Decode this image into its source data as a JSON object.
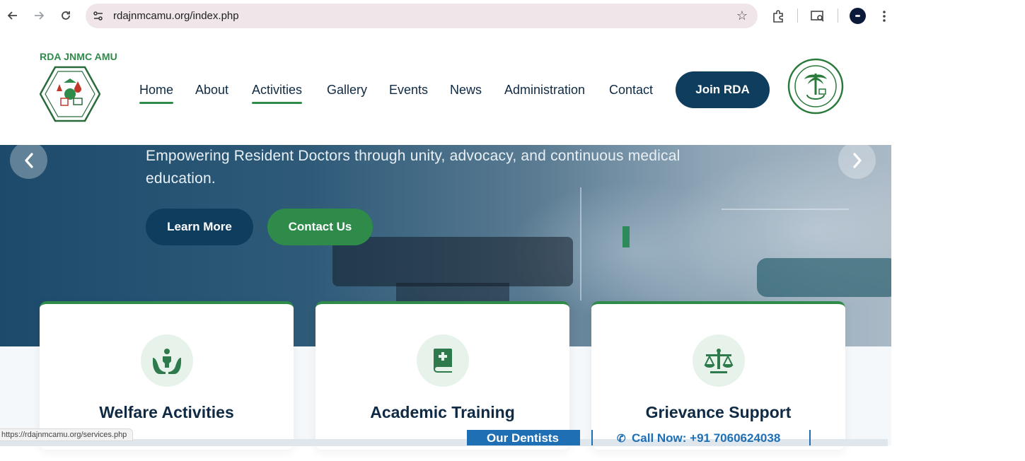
{
  "browser": {
    "url": "rdajnmcamu.org/index.php",
    "status_url": "https://rdajnmcamu.org/services.php",
    "icons": [
      "back-icon",
      "forward-icon",
      "reload-icon",
      "site-settings-icon",
      "bookmark-star-icon",
      "extensions-icon",
      "cast-search-icon",
      "profile-avatar",
      "menu-dots-icon"
    ]
  },
  "header": {
    "brand": "RDA JNMC AMU",
    "nav": [
      {
        "label": "Home",
        "active": true
      },
      {
        "label": "About",
        "active": false
      },
      {
        "label": "Activities",
        "active": true
      },
      {
        "label": "Gallery",
        "active": false
      },
      {
        "label": "Events",
        "active": false
      },
      {
        "label": "News",
        "active": false
      },
      {
        "label": "Administration",
        "active": false
      },
      {
        "label": "Contact",
        "active": false
      }
    ],
    "join_label": "Join RDA"
  },
  "hero": {
    "text": "Empowering Resident Doctors through unity, advocacy, and continuous medical education.",
    "learn_more": "Learn More",
    "contact_us": "Contact Us"
  },
  "cards": [
    {
      "title": "Welfare Activities",
      "icon": "hands-people-icon"
    },
    {
      "title": "Academic Training",
      "icon": "medical-book-icon"
    },
    {
      "title": "Grievance Support",
      "icon": "balance-scale-icon"
    }
  ],
  "bottom": {
    "dentists": "Our Dentists",
    "call": "Call Now: +91 7060624038"
  },
  "colors": {
    "green": "#2e8b4a",
    "navy": "#0f3d5e",
    "text_dark": "#0f2a44"
  }
}
